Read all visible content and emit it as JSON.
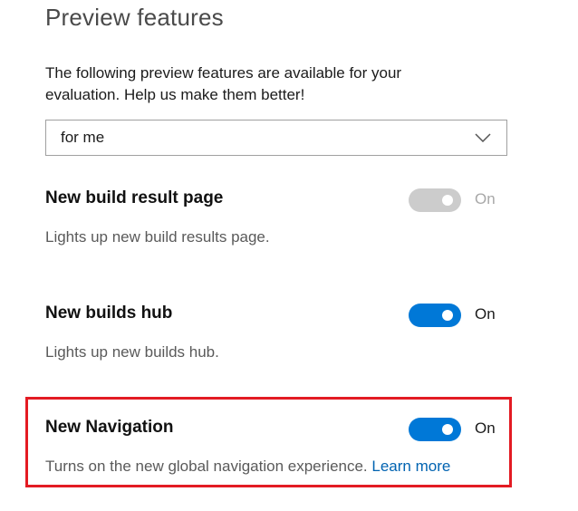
{
  "header": {
    "title": "Preview features",
    "description": "The following preview features are available for your evaluation. Help us make them better!"
  },
  "scope_dropdown": {
    "selected": "for me",
    "icon": "chevron-down-icon"
  },
  "features": [
    {
      "name": "New build result page",
      "description": "Lights up new build results page.",
      "state_label": "On",
      "enabled": true,
      "disabled": true
    },
    {
      "name": "New builds hub",
      "description": "Lights up new builds hub.",
      "state_label": "On",
      "enabled": true,
      "disabled": false
    },
    {
      "name": "New Navigation",
      "description": "Turns on the new global navigation experience.",
      "link_text": "Learn more",
      "state_label": "On",
      "enabled": true,
      "disabled": false,
      "highlighted": true
    }
  ],
  "colors": {
    "toggle_on": "#0078d7",
    "toggle_disabled": "#cccccc",
    "link": "#0063b1",
    "highlight_border": "#e31b23"
  }
}
